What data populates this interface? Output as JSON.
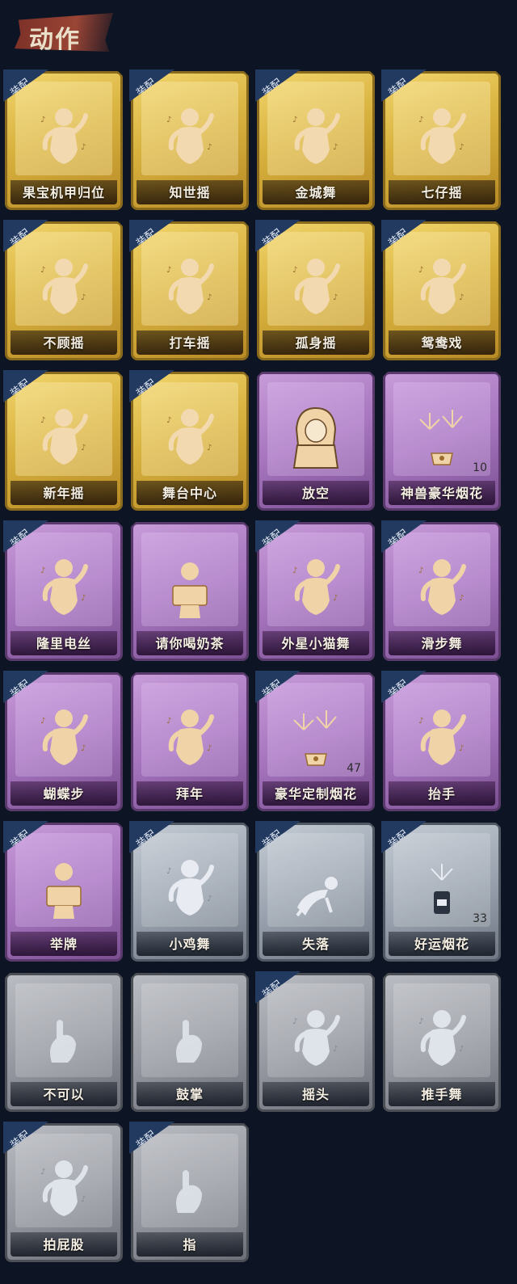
{
  "header": {
    "title": "动作"
  },
  "equip_label": "装配",
  "cards": [
    {
      "label": "果宝机甲归位",
      "tier": "gold",
      "equipped": true,
      "icon": "dancer-icon",
      "count": ""
    },
    {
      "label": "知世摇",
      "tier": "gold",
      "equipped": true,
      "icon": "dancer-icon",
      "count": ""
    },
    {
      "label": "金城舞",
      "tier": "gold",
      "equipped": true,
      "icon": "dancer-icon",
      "count": ""
    },
    {
      "label": "七仔摇",
      "tier": "gold",
      "equipped": true,
      "icon": "dancer-icon",
      "count": ""
    },
    {
      "label": "不顾摇",
      "tier": "gold",
      "equipped": true,
      "icon": "dancer-icon",
      "count": ""
    },
    {
      "label": "打车摇",
      "tier": "gold",
      "equipped": true,
      "icon": "dancer-icon",
      "count": ""
    },
    {
      "label": "孤身摇",
      "tier": "gold",
      "equipped": true,
      "icon": "dancer-icon",
      "count": ""
    },
    {
      "label": "鸳鸯戏",
      "tier": "gold",
      "equipped": true,
      "icon": "dancer-icon",
      "count": ""
    },
    {
      "label": "新年摇",
      "tier": "gold",
      "equipped": true,
      "icon": "dancer-icon",
      "count": ""
    },
    {
      "label": "舞台中心",
      "tier": "gold",
      "equipped": true,
      "icon": "dancer-icon",
      "count": ""
    },
    {
      "label": "放空",
      "tier": "purple",
      "equipped": false,
      "icon": "hooded-figure-icon",
      "count": ""
    },
    {
      "label": "神兽豪华烟花",
      "tier": "purple",
      "equipped": false,
      "icon": "fireworks-icon",
      "count": "10"
    },
    {
      "label": "隆里电丝",
      "tier": "purple",
      "equipped": true,
      "icon": "dancer-icon",
      "count": ""
    },
    {
      "label": "请你喝奶茶",
      "tier": "purple",
      "equipped": false,
      "icon": "sign-holder-icon",
      "count": ""
    },
    {
      "label": "外星小猫舞",
      "tier": "purple",
      "equipped": true,
      "icon": "dancer-icon",
      "count": ""
    },
    {
      "label": "滑步舞",
      "tier": "purple",
      "equipped": true,
      "icon": "dancer-icon",
      "count": ""
    },
    {
      "label": "蝴蝶步",
      "tier": "purple",
      "equipped": true,
      "icon": "dancer-icon",
      "count": ""
    },
    {
      "label": "拜年",
      "tier": "purple",
      "equipped": false,
      "icon": "bowing-figure-icon",
      "count": ""
    },
    {
      "label": "豪华定制烟花",
      "tier": "purple",
      "equipped": true,
      "icon": "fireworks-icon",
      "count": "47"
    },
    {
      "label": "抬手",
      "tier": "purple",
      "equipped": true,
      "icon": "raise-hand-icon",
      "count": ""
    },
    {
      "label": "举牌",
      "tier": "purple",
      "equipped": true,
      "icon": "sign-holder-icon",
      "count": ""
    },
    {
      "label": "小鸡舞",
      "tier": "silver",
      "equipped": true,
      "icon": "dancer-icon",
      "count": ""
    },
    {
      "label": "失落",
      "tier": "silver",
      "equipped": true,
      "icon": "crawling-figure-icon",
      "count": ""
    },
    {
      "label": "好运烟花",
      "tier": "silver",
      "equipped": true,
      "icon": "firework-can-icon",
      "count": "33"
    },
    {
      "label": "不可以",
      "tier": "gray",
      "equipped": false,
      "icon": "finger-wag-icon",
      "count": ""
    },
    {
      "label": "鼓掌",
      "tier": "gray",
      "equipped": false,
      "icon": "clapping-icon",
      "count": ""
    },
    {
      "label": "摇头",
      "tier": "gray",
      "equipped": true,
      "icon": "head-shake-icon",
      "count": ""
    },
    {
      "label": "推手舞",
      "tier": "gray",
      "equipped": false,
      "icon": "dancer-icon",
      "count": ""
    },
    {
      "label": "拍屁股",
      "tier": "gray",
      "equipped": true,
      "icon": "dancer-icon",
      "count": ""
    },
    {
      "label": "指",
      "tier": "gray",
      "equipped": true,
      "icon": "pointing-hand-icon",
      "count": ""
    }
  ]
}
